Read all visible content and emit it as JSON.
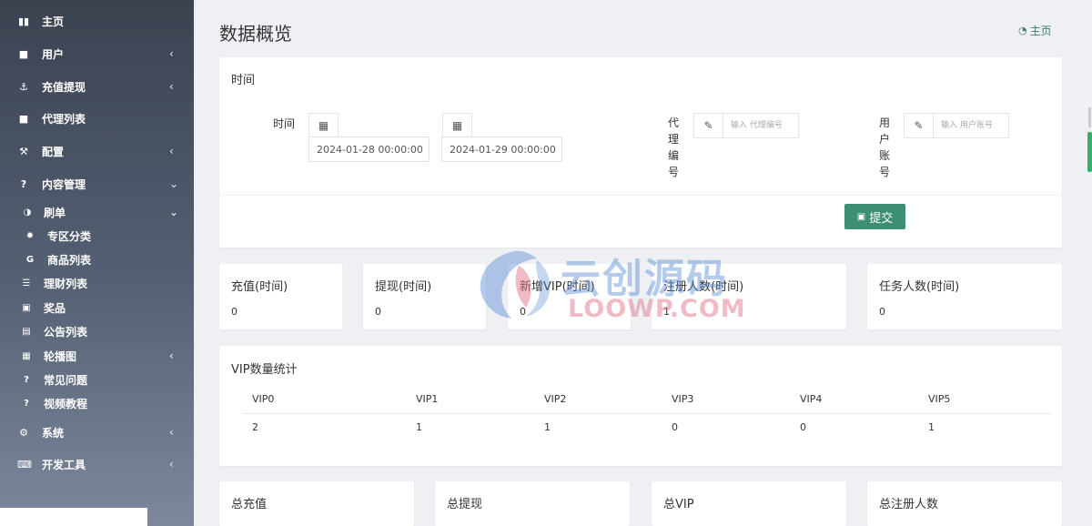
{
  "sidebar": {
    "items": [
      {
        "label": "主页",
        "icon": "bar-chart-icon",
        "glyph": "▮▮",
        "chevron": ""
      },
      {
        "label": "用户",
        "icon": "user-icon",
        "glyph": "■",
        "chevron": "‹"
      },
      {
        "label": "充值提现",
        "icon": "anchor-icon",
        "glyph": "⚓",
        "chevron": "‹"
      },
      {
        "label": "代理列表",
        "icon": "id-card-icon",
        "glyph": "■",
        "chevron": ""
      },
      {
        "label": "配置",
        "icon": "magic-wand-icon",
        "glyph": "⚒",
        "chevron": "‹"
      },
      {
        "label": "内容管理",
        "icon": "question-circle-icon",
        "glyph": "?",
        "chevron": "⌄"
      }
    ],
    "subitems": [
      {
        "label": "刷单",
        "icon": "adjust-icon",
        "glyph": "◑",
        "chevron": "⌄"
      },
      {
        "label": "专区分类",
        "icon": "gear-icon",
        "glyph": "✹",
        "chevron": ""
      },
      {
        "label": "商品列表",
        "icon": "google-icon",
        "glyph": "G",
        "chevron": ""
      },
      {
        "label": "理财列表",
        "icon": "list-icon",
        "glyph": "☰",
        "chevron": ""
      },
      {
        "label": "奖品",
        "icon": "money-icon",
        "glyph": "▣",
        "chevron": ""
      },
      {
        "label": "公告列表",
        "icon": "file-icon",
        "glyph": "▤",
        "chevron": ""
      },
      {
        "label": "轮播图",
        "icon": "image-icon",
        "glyph": "▦",
        "chevron": "‹"
      },
      {
        "label": "常见问题",
        "icon": "question-circle-icon",
        "glyph": "?",
        "chevron": ""
      },
      {
        "label": "视频教程",
        "icon": "question-circle-icon",
        "glyph": "?",
        "chevron": ""
      }
    ],
    "bottom": [
      {
        "label": "系统",
        "icon": "cog-icon",
        "glyph": "⚙",
        "chevron": "‹"
      },
      {
        "label": "开发工具",
        "icon": "keyboard-icon",
        "glyph": "⌨",
        "chevron": "‹"
      }
    ]
  },
  "header": {
    "title": "数据概览",
    "breadcrumb": "主页",
    "breadcrumb_icon": "dashboard-icon"
  },
  "filter": {
    "title": "时间",
    "time_label": "时间",
    "start_date": "2024-01-28 00:00:00",
    "end_date": "2024-01-29 00:00:00",
    "agent_label": "代理编号",
    "agent_placeholder": "输入 代理编号",
    "user_label": "用户账号",
    "user_placeholder": "输入 用户账号",
    "submit_label": "提交"
  },
  "stats": [
    {
      "label": "充值(时间)",
      "value": "0"
    },
    {
      "label": "提现(时间)",
      "value": "0"
    },
    {
      "label": "新增VIP(时间)",
      "value": "0"
    },
    {
      "label": "注册人数(时间)",
      "value": "1"
    },
    {
      "label": "任务人数(时间)",
      "value": "0"
    }
  ],
  "vip": {
    "title": "VIP数量统计",
    "headers": [
      "VIP0",
      "VIP1",
      "VIP2",
      "VIP3",
      "VIP4",
      "VIP5"
    ],
    "values": [
      "2",
      "1",
      "1",
      "0",
      "0",
      "1"
    ]
  },
  "totals": [
    {
      "label": "总充值"
    },
    {
      "label": "总提现"
    },
    {
      "label": "总VIP"
    },
    {
      "label": "总注册人数"
    }
  ],
  "watermark": {
    "cn": "云创源码",
    "en": "LOOWP.COM"
  },
  "colors": {
    "accent": "#3d8f71",
    "sidebar_top": "#3b4250",
    "sidebar_bottom": "#7d889c",
    "background": "#eef0f4"
  }
}
